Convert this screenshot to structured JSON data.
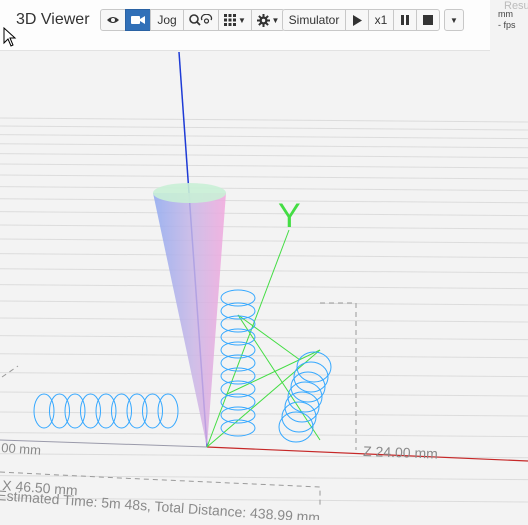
{
  "viewer": {
    "title": "3D Viewer",
    "toolbar": {
      "jog_label": "Jog",
      "simulator_label": "Simulator",
      "speed_label": "x1"
    },
    "stats": {
      "faded_label": "Resu",
      "unit": "mm",
      "fps": "- fps"
    }
  },
  "scene": {
    "axis_label_y": "Y",
    "x_dimension": "X 46.50 mm",
    "z_dimension": "Z 24.00 mm",
    "left_dimension": "00 mm",
    "estimate": "Estimated Time: 5m 48s, Total Distance: 438.99 mm",
    "colors": {
      "x_axis": "#c62828",
      "y_axis": "#00c853",
      "z_axis": "#1e3bd6",
      "toolpath": "#35a8ff",
      "toolpath_green": "#44dd44",
      "active_button": "#3170b8"
    }
  }
}
